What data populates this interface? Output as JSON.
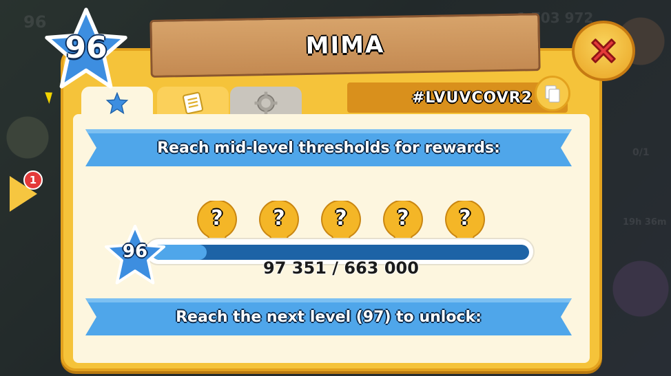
{
  "background": {
    "level": "96",
    "top_count": "1 703 972",
    "ratio": "0/1",
    "time": "19h 36m"
  },
  "side_badge": {
    "count": "1"
  },
  "dialog": {
    "player_name": "MIMA",
    "level": "96",
    "player_tag": "#LVUVCOVR2",
    "tabs": [
      {
        "name": "stars",
        "icon": "star-icon",
        "selected": true
      },
      {
        "name": "notes",
        "icon": "notepad-icon",
        "selected": false
      },
      {
        "name": "settings",
        "icon": "gear-icon",
        "selected": false
      }
    ],
    "reward_heading": "Reach mid-level thresholds for rewards:",
    "reward_slots": [
      "?",
      "?",
      "?",
      "?",
      "?"
    ],
    "progress": {
      "level": "96",
      "label": "97 351 / 663 000",
      "current": 97351,
      "max": 663000
    },
    "unlock_text": "Reach the next level (97) to unlock:"
  },
  "colors": {
    "panel": "#f5c33a",
    "ribbon": "#4fa6ea",
    "progress_fill": "#4fa6ea",
    "progress_track": "#1d63a6",
    "close_x": "#e43a3a"
  }
}
